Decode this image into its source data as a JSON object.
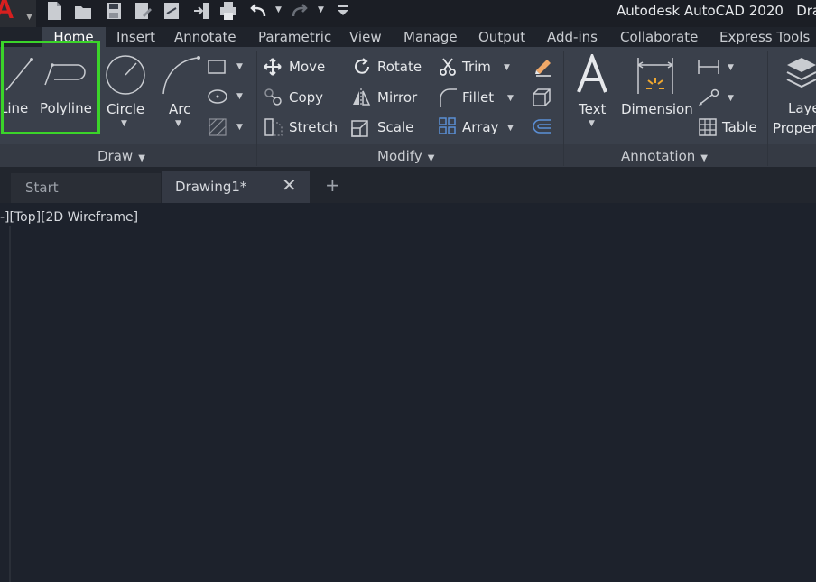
{
  "title_bar": {
    "title": "Autodesk AutoCAD 2020",
    "title_suffix": "Draw"
  },
  "app_button": {
    "letter": "A"
  },
  "ribbon_tabs": [
    "Home",
    "Insert",
    "Annotate",
    "Parametric",
    "View",
    "Manage",
    "Output",
    "Add-ins",
    "Collaborate",
    "Express Tools"
  ],
  "draw_panel": {
    "line": "Line",
    "polyline": "Polyline",
    "circle": "Circle",
    "arc": "Arc",
    "label": "Draw"
  },
  "modify_panel": {
    "move": "Move",
    "rotate": "Rotate",
    "trim": "Trim",
    "copy": "Copy",
    "mirror": "Mirror",
    "fillet": "Fillet",
    "stretch": "Stretch",
    "scale": "Scale",
    "array": "Array",
    "label": "Modify"
  },
  "annotation_panel": {
    "text": "Text",
    "dimension": "Dimension",
    "table": "Table",
    "label": "Annotation"
  },
  "layers_panel": {
    "line1": "Laye",
    "line2": "Proper"
  },
  "file_tabs": {
    "start": "Start",
    "drawing": "Drawing1*"
  },
  "viewport": {
    "label": "-][Top][2D Wireframe]"
  },
  "colors": {
    "highlight": "#3bd42a",
    "brand": "#d61f1f",
    "ribbon": "#3a404b",
    "canvas": "#1d222c"
  }
}
